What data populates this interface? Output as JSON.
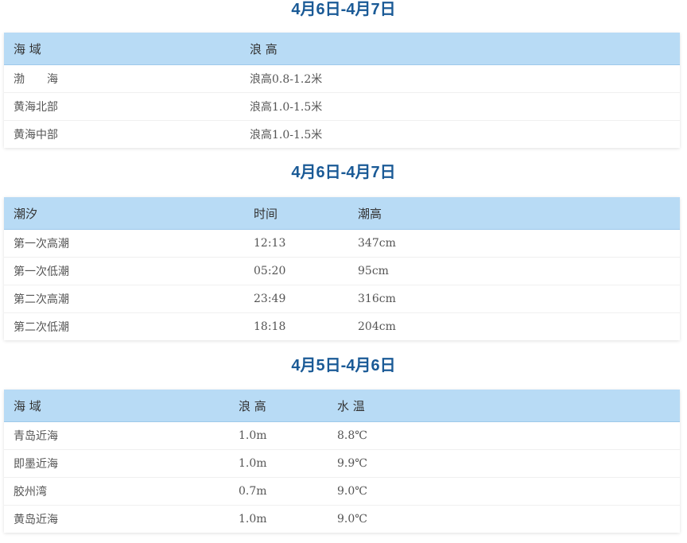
{
  "sections": [
    {
      "title": "4月6日-4月7日",
      "headers": [
        "海 域",
        "浪 高"
      ],
      "rows": [
        [
          "渤　　海",
          "浪高0.8-1.2米"
        ],
        [
          "黄海北部",
          "浪高1.0-1.5米"
        ],
        [
          "黄海中部",
          "浪高1.0-1.5米"
        ]
      ]
    },
    {
      "title": "4月6日-4月7日",
      "headers": [
        "潮汐",
        "时间",
        "潮高"
      ],
      "rows": [
        [
          "第一次高潮",
          "12:13",
          "347cm"
        ],
        [
          "第一次低潮",
          "05:20",
          "95cm"
        ],
        [
          "第二次高潮",
          "23:49",
          "316cm"
        ],
        [
          "第二次低潮",
          "18:18",
          "204cm"
        ]
      ]
    },
    {
      "title": "4月5日-4月6日",
      "headers": [
        "海 域",
        "浪 高",
        "水 温"
      ],
      "rows": [
        [
          "青岛近海",
          "1.0m",
          "8.8℃"
        ],
        [
          "即墨近海",
          "1.0m",
          "9.9℃"
        ],
        [
          "胶州湾",
          "0.7m",
          "9.0℃"
        ],
        [
          "黄岛近海",
          "1.0m",
          "9.0℃"
        ]
      ]
    }
  ]
}
